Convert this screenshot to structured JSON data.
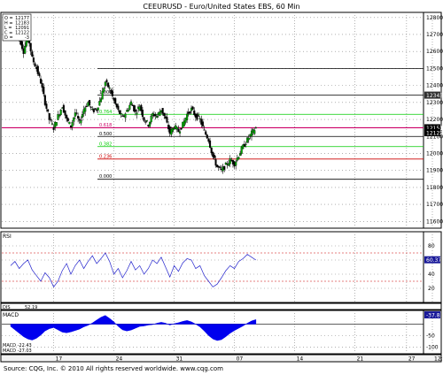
{
  "chart_data": {
    "title": "CEEURUSD - Euro/United States EBS, 60 Min",
    "source": "Source: CQG, Inc. © 2010 All rights reserved worldwide. www.cqg.com",
    "info_box": [
      {
        "label": "O",
        "value": "12177"
      },
      {
        "label": "H",
        "value": "12183"
      },
      {
        "label": "L",
        "value": "12091"
      },
      {
        "label": "C",
        "value": "12122"
      },
      {
        "label": "D",
        "value": "-3"
      }
    ],
    "x_ticks": [
      "17",
      "24",
      "31",
      "07",
      "14",
      "21",
      "27",
      "12:00"
    ],
    "x_tick_values": [
      17,
      24,
      31,
      38,
      45,
      52,
      58,
      61
    ],
    "price_panel": {
      "type": "candlestick",
      "y_ticks": [
        11600,
        11700,
        11800,
        11900,
        12000,
        12100,
        12200,
        12300,
        12400,
        12500,
        12600,
        12700,
        12800
      ],
      "ylim": [
        11560,
        12830
      ],
      "last_price_labels": [
        {
          "value": 12343,
          "text": "12343",
          "color": "#303030"
        },
        {
          "value": 12151,
          "text": "12151",
          "color": "#000000"
        },
        {
          "value": 12122,
          "text": "12122",
          "color": "#000000"
        }
      ],
      "fib_levels": [
        {
          "label": "1.000",
          "value": 12344,
          "color": "#000000"
        },
        {
          "label": "0.764",
          "value": 12230,
          "color": "#00cc00"
        },
        {
          "label": "0.618",
          "value": 12151,
          "color": "#cc0066"
        },
        {
          "label": "0.500",
          "value": 12100,
          "color": "#000000"
        },
        {
          "label": "0.382",
          "value": 12040,
          "color": "#00cc00"
        },
        {
          "label": "0.236",
          "value": 11967,
          "color": "#cc0000"
        },
        {
          "label": "0.000",
          "value": 11848,
          "color": "#000000"
        }
      ],
      "extra_lines": [
        {
          "value": 12500,
          "color": "#000000"
        }
      ],
      "close_path": [
        [
          12,
          12770
        ],
        [
          13,
          12680
        ],
        [
          13.5,
          12600
        ],
        [
          14,
          12700
        ],
        [
          14.5,
          12560
        ],
        [
          15,
          12500
        ],
        [
          15.5,
          12420
        ],
        [
          16,
          12300
        ],
        [
          16.5,
          12200
        ],
        [
          17,
          12150
        ],
        [
          17.5,
          12220
        ],
        [
          18,
          12280
        ],
        [
          18.5,
          12200
        ],
        [
          19,
          12160
        ],
        [
          19.5,
          12240
        ],
        [
          20,
          12180
        ],
        [
          20.5,
          12260
        ],
        [
          21,
          12300
        ],
        [
          21.5,
          12250
        ],
        [
          22,
          12260
        ],
        [
          22.5,
          12330
        ],
        [
          23,
          12420
        ],
        [
          23.5,
          12380
        ],
        [
          24,
          12310
        ],
        [
          24.5,
          12250
        ],
        [
          25,
          12210
        ],
        [
          25.5,
          12250
        ],
        [
          26,
          12300
        ],
        [
          26.5,
          12240
        ],
        [
          27,
          12280
        ],
        [
          27.5,
          12200
        ],
        [
          28,
          12170
        ],
        [
          28.5,
          12230
        ],
        [
          29,
          12220
        ],
        [
          29.5,
          12260
        ],
        [
          30,
          12200
        ],
        [
          30.5,
          12120
        ],
        [
          31,
          12160
        ],
        [
          31.5,
          12130
        ],
        [
          32,
          12170
        ],
        [
          32.5,
          12230
        ],
        [
          33,
          12260
        ],
        [
          33.5,
          12220
        ],
        [
          34,
          12200
        ],
        [
          34.5,
          12130
        ],
        [
          35,
          12080
        ],
        [
          35.5,
          11980
        ],
        [
          36,
          11920
        ],
        [
          36.5,
          11900
        ],
        [
          37,
          11930
        ],
        [
          37.5,
          11960
        ],
        [
          38,
          11940
        ],
        [
          38.5,
          11990
        ],
        [
          39,
          12040
        ],
        [
          39.5,
          12080
        ],
        [
          40,
          12120
        ],
        [
          40.5,
          12150
        ]
      ]
    },
    "rsi_panel": {
      "label": "RSI",
      "value_label": "60.37",
      "y_ticks": [
        20,
        40,
        60,
        80
      ],
      "ylim": [
        0,
        100
      ],
      "levels": [
        70,
        30
      ],
      "series": [
        [
          12,
          52
        ],
        [
          12.5,
          58
        ],
        [
          13,
          48
        ],
        [
          13.5,
          55
        ],
        [
          14,
          60
        ],
        [
          14.5,
          46
        ],
        [
          15,
          38
        ],
        [
          15.5,
          30
        ],
        [
          16,
          42
        ],
        [
          16.5,
          35
        ],
        [
          17,
          22
        ],
        [
          17.5,
          30
        ],
        [
          18,
          45
        ],
        [
          18.5,
          55
        ],
        [
          19,
          40
        ],
        [
          19.5,
          52
        ],
        [
          20,
          60
        ],
        [
          20.5,
          48
        ],
        [
          21,
          58
        ],
        [
          21.5,
          66
        ],
        [
          22,
          55
        ],
        [
          22.5,
          62
        ],
        [
          23,
          70
        ],
        [
          23.5,
          58
        ],
        [
          24,
          40
        ],
        [
          24.5,
          48
        ],
        [
          25,
          35
        ],
        [
          25.5,
          45
        ],
        [
          26,
          58
        ],
        [
          26.5,
          46
        ],
        [
          27,
          52
        ],
        [
          27.5,
          40
        ],
        [
          28,
          48
        ],
        [
          28.5,
          60
        ],
        [
          29,
          55
        ],
        [
          29.5,
          64
        ],
        [
          30,
          50
        ],
        [
          30.5,
          36
        ],
        [
          31,
          52
        ],
        [
          31.5,
          44
        ],
        [
          32,
          56
        ],
        [
          32.5,
          62
        ],
        [
          33,
          60
        ],
        [
          33.5,
          48
        ],
        [
          34,
          52
        ],
        [
          34.5,
          38
        ],
        [
          35,
          30
        ],
        [
          35.5,
          22
        ],
        [
          36,
          26
        ],
        [
          36.5,
          35
        ],
        [
          37,
          45
        ],
        [
          37.5,
          52
        ],
        [
          38,
          48
        ],
        [
          38.5,
          58
        ],
        [
          39,
          62
        ],
        [
          39.5,
          68
        ],
        [
          40,
          64
        ],
        [
          40.5,
          60
        ]
      ]
    },
    "macd_panel": {
      "label": "MACD",
      "readouts": [
        "MACD  -22.43",
        "MACD  -27.03"
      ],
      "value_label": "-37.8",
      "y_ticks": [
        -100,
        -50
      ],
      "ylim": [
        -130,
        60
      ],
      "histogram": [
        [
          12,
          -10
        ],
        [
          12.5,
          -25
        ],
        [
          13,
          -40
        ],
        [
          13.5,
          -55
        ],
        [
          14,
          -65
        ],
        [
          14.5,
          -70
        ],
        [
          15,
          -62
        ],
        [
          15.5,
          -48
        ],
        [
          16,
          -30
        ],
        [
          16.5,
          -20
        ],
        [
          17,
          -15
        ],
        [
          17.5,
          -25
        ],
        [
          18,
          -35
        ],
        [
          18.5,
          -38
        ],
        [
          19,
          -34
        ],
        [
          19.5,
          -28
        ],
        [
          20,
          -22
        ],
        [
          20.5,
          -12
        ],
        [
          21,
          -5
        ],
        [
          21.5,
          5
        ],
        [
          22,
          18
        ],
        [
          22.5,
          30
        ],
        [
          23,
          38
        ],
        [
          23.5,
          25
        ],
        [
          24,
          10
        ],
        [
          24.5,
          -10
        ],
        [
          25,
          -25
        ],
        [
          25.5,
          -30
        ],
        [
          26,
          -26
        ],
        [
          26.5,
          -18
        ],
        [
          27,
          -10
        ],
        [
          27.5,
          -8
        ],
        [
          28,
          -4
        ],
        [
          28.5,
          -2
        ],
        [
          29,
          4
        ],
        [
          29.5,
          8
        ],
        [
          30,
          4
        ],
        [
          30.5,
          -4
        ],
        [
          31,
          2
        ],
        [
          31.5,
          6
        ],
        [
          32,
          12
        ],
        [
          32.5,
          16
        ],
        [
          33,
          10
        ],
        [
          33.5,
          0
        ],
        [
          34,
          -12
        ],
        [
          34.5,
          -30
        ],
        [
          35,
          -50
        ],
        [
          35.5,
          -65
        ],
        [
          36,
          -72
        ],
        [
          36.5,
          -68
        ],
        [
          37,
          -55
        ],
        [
          37.5,
          -40
        ],
        [
          38,
          -28
        ],
        [
          38.5,
          -18
        ],
        [
          39,
          -8
        ],
        [
          39.5,
          4
        ],
        [
          40,
          14
        ],
        [
          40.5,
          20
        ]
      ]
    },
    "sub_label": "52.19",
    "colors": {
      "candle_up": "#00aa00",
      "candle_down": "#000000",
      "rsi_line": "#2222cc",
      "macd_fill": "#0000ee",
      "axis_tag_bg": "#000000",
      "grid": "#808080"
    }
  }
}
